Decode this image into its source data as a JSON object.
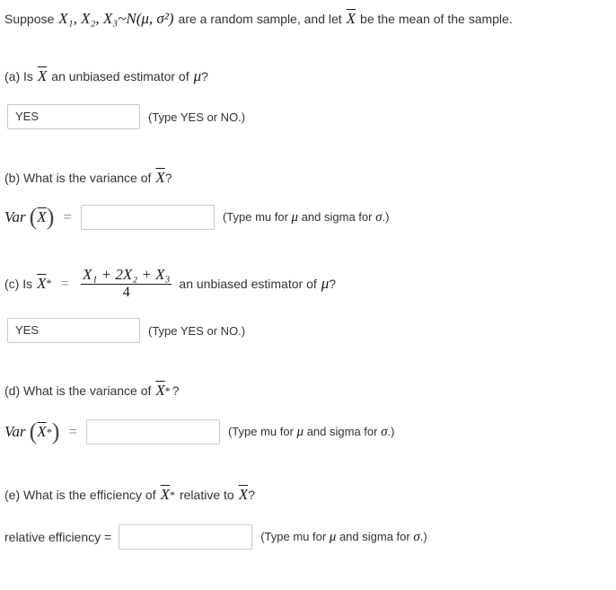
{
  "intro": {
    "prefix": "Suppose",
    "sample": "X₁, X₂, X₃",
    "dist": "~N(μ, σ²)",
    "mid": "are a random sample, and let",
    "xbar": "X",
    "suffix": "be the mean of the sample."
  },
  "part_a": {
    "question_prefix": "(a) Is",
    "xbar": "X",
    "question_suffix": "an unbiased estimator of",
    "mu": "μ",
    "qmark": "?",
    "answer": "YES",
    "hint": "(Type YES or NO.)"
  },
  "part_b": {
    "question_prefix": "(b) What is the variance of",
    "xbar": "X",
    "qmark": "?",
    "var_label": "Var",
    "equals": "=",
    "answer": "",
    "hint_prefix": "(Type mu for",
    "hint_mu": "μ",
    "hint_mid": "and sigma for",
    "hint_sigma": "σ",
    "hint_suffix": ".)"
  },
  "part_c": {
    "question_prefix": "(c) Is",
    "xstar": "X",
    "star": "*",
    "equals": "=",
    "numerator": "X₁ + 2X₂ + X₃",
    "denominator": "4",
    "question_suffix": "an unbiased estimator of",
    "mu": "μ",
    "qmark": "?",
    "answer": "YES",
    "hint": "(Type YES or NO.)"
  },
  "part_d": {
    "question_prefix": "(d) What is the variance of",
    "xstar": "X",
    "star": "*",
    "qmark": "?",
    "var_label": "Var",
    "equals": "=",
    "answer": "",
    "hint_prefix": "(Type mu for",
    "hint_mu": "μ",
    "hint_mid": "and sigma for",
    "hint_sigma": "σ",
    "hint_suffix": ".)"
  },
  "part_e": {
    "question_prefix": "(e) What is the efficiency of",
    "xstar": "X",
    "star": "*",
    "question_mid": "relative to",
    "xbar": "X",
    "qmark": "?",
    "label": "relative efficiency =",
    "answer": "",
    "hint_prefix": "(Type mu for",
    "hint_mu": "μ",
    "hint_mid": "and sigma for",
    "hint_sigma": "σ",
    "hint_suffix": ".)"
  }
}
